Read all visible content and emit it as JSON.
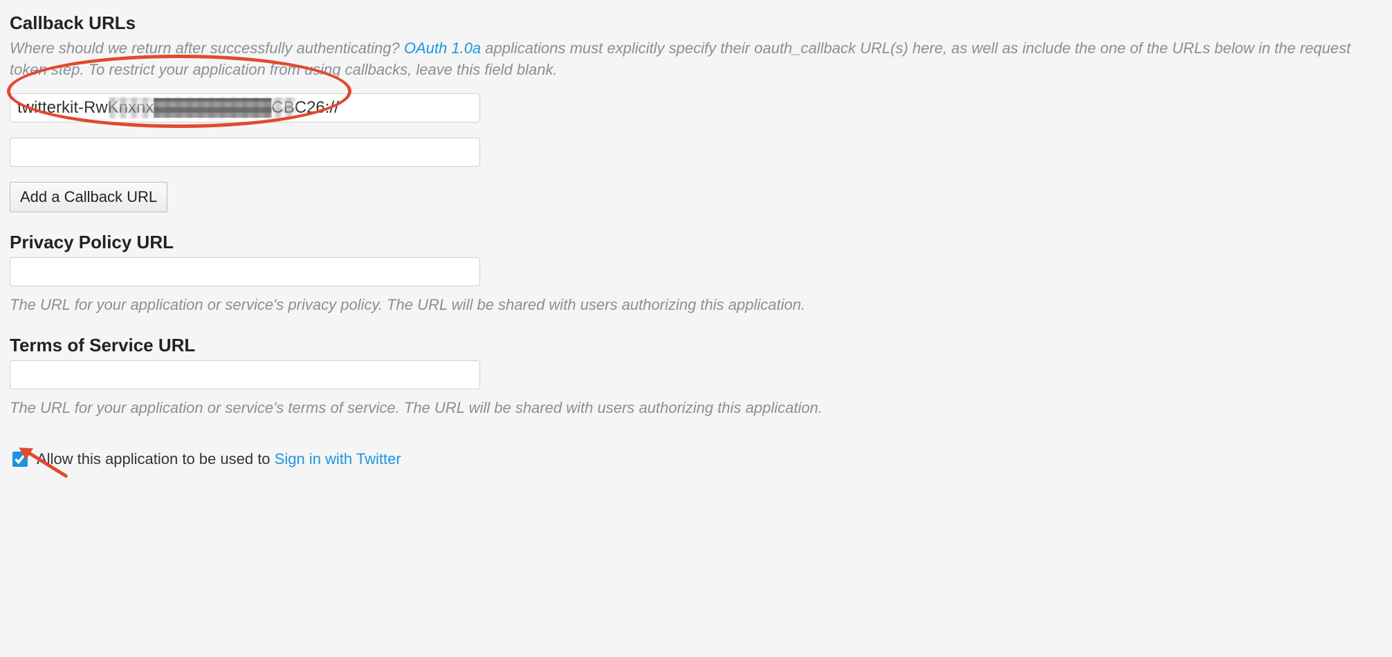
{
  "callback": {
    "heading": "Callback URLs",
    "help_prefix": "Where should we return after successfully authenticating? ",
    "oauth_link": "OAuth 1.0a",
    "help_suffix": " applications must explicitly specify their oauth_callback URL(s) here, as well as include the one of the URLs below in the request token step. To restrict your application from using callbacks, leave this field blank.",
    "url1_value": "twitterkit-RwKnxnx██████████CBC26://",
    "url2_value": "",
    "add_button": "Add a Callback URL"
  },
  "privacy": {
    "heading": "Privacy Policy URL",
    "value": "",
    "help": "The URL for your application or service's privacy policy. The URL will be shared with users authorizing this application."
  },
  "tos": {
    "heading": "Terms of Service URL",
    "value": "",
    "help": "The URL for your application or service's terms of service. The URL will be shared with users authorizing this application."
  },
  "signin": {
    "checked": true,
    "label_prefix": "Allow this application to be used to ",
    "label_link": "Sign in with Twitter"
  }
}
